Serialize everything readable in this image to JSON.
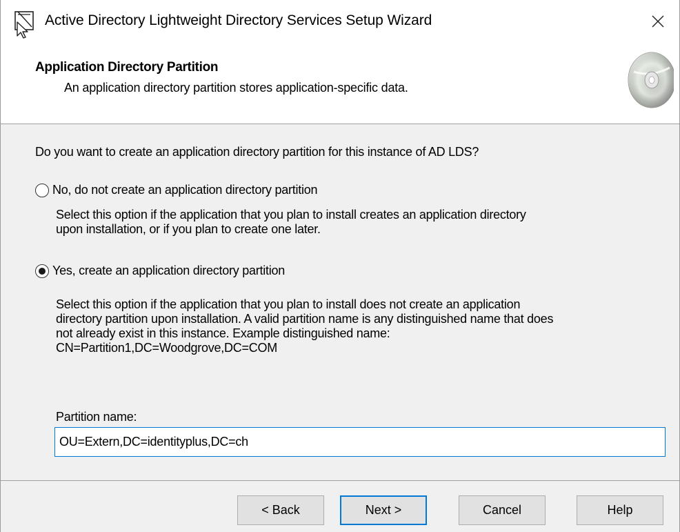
{
  "window": {
    "title": "Active Directory Lightweight Directory Services Setup Wizard",
    "close_glyph": "✕"
  },
  "header": {
    "title": "Application Directory Partition",
    "subtitle": "An application directory partition stores application-specific data."
  },
  "content": {
    "question": "Do you want to create an application directory partition for this instance of AD LDS?",
    "option_no": {
      "label": "No, do not create an application directory partition",
      "selected": false,
      "description": [
        "Select this option if the application that you plan to install creates an application directory",
        "upon installation, or if you plan to create one later."
      ]
    },
    "option_yes": {
      "label": "Yes, create an application directory partition",
      "selected": true,
      "description": [
        "Select this option if the application that you plan to install does not create an application",
        "directory partition upon installation. A valid partition name is any distinguished name that does",
        "not already exist in this instance. Example distinguished name:",
        "CN=Partition1,DC=Woodgrove,DC=COM"
      ]
    },
    "partition_label": "Partition name:",
    "partition_value": "OU=Extern,DC=identityplus,DC=ch"
  },
  "buttons": {
    "back": "< Back",
    "next": "Next >",
    "cancel": "Cancel",
    "help": "Help"
  },
  "colors": {
    "accent": "#0078d7",
    "button_face": "#e1e1e1",
    "dialog_bg": "#f0f0f0"
  }
}
